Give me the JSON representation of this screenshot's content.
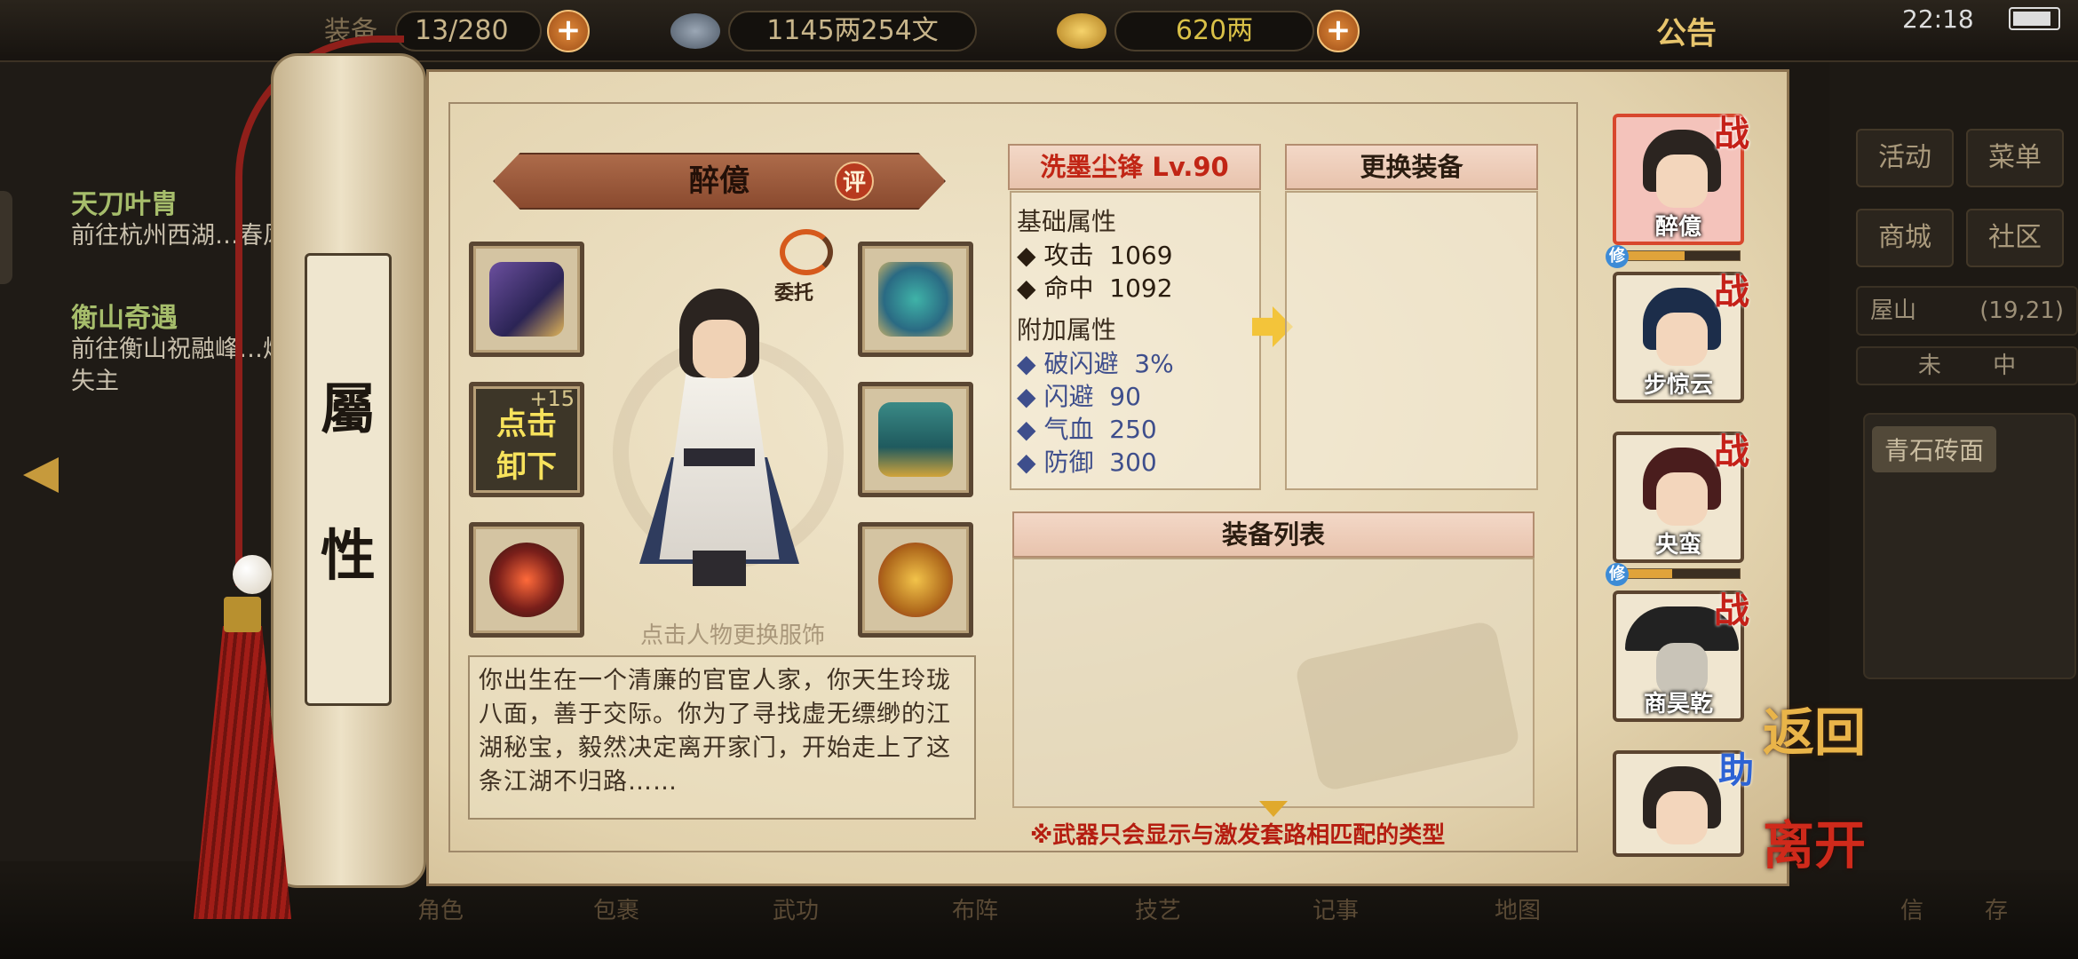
{
  "status_bar": {
    "time": "22:18"
  },
  "top_bar": {
    "bag_label": "装备",
    "bag_count": "13/280",
    "money": "1145两254文",
    "gold": "620两",
    "notice": "公告"
  },
  "quests": [
    {
      "title": "天刀叶胄",
      "desc": "前往杭州西湖…春风"
    },
    {
      "title": "衡山奇遇",
      "desc": "前往衡山祝融峰…烛失主"
    }
  ],
  "right_menu": {
    "buttons": [
      "活动",
      "菜单",
      "商城",
      "社区"
    ],
    "location": "屋山",
    "coords": "(19,21)",
    "brick": "青石砖面",
    "compass": [
      "未",
      "中"
    ]
  },
  "scroll": {
    "chars": [
      "屬",
      "性"
    ]
  },
  "character": {
    "name": "醉億",
    "rate_badge": "评",
    "delegate": "委托",
    "unequip_line1": "点击",
    "unequip_line2": "卸下",
    "enhance": "+15",
    "change_outfit_hint": "点击人物更换服饰",
    "bio": "你出生在一个清廉的官宦人家，你天生玲珑八面，善于交际。你为了寻找虚无缥缈的江湖秘宝，毅然决定离开家门，开始走上了这条江湖不归路……"
  },
  "weapon": {
    "title": "洗墨尘锋 Lv.90",
    "base_header": "基础属性",
    "base_stats": [
      {
        "label": "攻击",
        "value": "1069"
      },
      {
        "label": "命中",
        "value": "1092"
      }
    ],
    "extra_header": "附加属性",
    "extra_stats": [
      {
        "label": "破闪避",
        "value": "3%"
      },
      {
        "label": "闪避",
        "value": "90"
      },
      {
        "label": "气血",
        "value": "250"
      },
      {
        "label": "防御",
        "value": "300"
      }
    ]
  },
  "change_equipment": {
    "title": "更换装备"
  },
  "equipment_list": {
    "title": "装备列表",
    "note": "※武器只会显示与激发套路相匹配的类型"
  },
  "party": [
    {
      "name": "醉億",
      "role": "战",
      "selected": true,
      "xp": 0.55
    },
    {
      "name": "步惊云",
      "role": "战",
      "selected": false
    },
    {
      "name": "央蛮",
      "role": "战",
      "selected": false,
      "xp": 0.45
    },
    {
      "name": "商昊乾",
      "role": "战",
      "selected": false
    },
    {
      "name": "",
      "role": "助",
      "selected": false
    }
  ],
  "cultivate_badge": "修",
  "actions": {
    "return": "返回",
    "leave": "离开"
  },
  "bottom_nav": [
    "角色",
    "包裹",
    "武功",
    "布阵",
    "技艺",
    "记事",
    "地图"
  ],
  "bottom_right": [
    "信",
    "存"
  ],
  "colors": {
    "accent_red": "#c12515",
    "stat_blue": "#3e4e8c",
    "unequip_yellow": "#f7e25c"
  }
}
